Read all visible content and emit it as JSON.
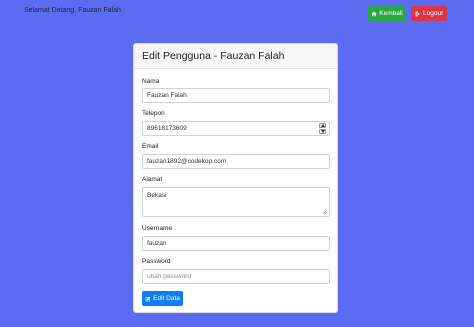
{
  "header": {
    "welcome": "Selamat Datang, Fauzan Falah",
    "back_label": "Kembali",
    "logout_label": "Logout"
  },
  "card": {
    "title": "Edit Pengguna - Fauzan Falah"
  },
  "form": {
    "nama_label": "Nama",
    "nama_value": "Fauzan Falah",
    "telepon_label": "Telepon",
    "telepon_value": "89618173609",
    "email_label": "Email",
    "email_value": "fauzan1892@codekop.com",
    "alamat_label": "Alamat",
    "alamat_value": "Bekasi",
    "username_label": "Username",
    "username_value": "fauzan",
    "password_label": "Password",
    "password_placeholder": "ubah password",
    "submit_label": "Edit Data"
  },
  "colors": {
    "background": "#5b6cf3",
    "back_button": "#28a745",
    "logout_button": "#dc3545",
    "submit_button": "#0d7ef5"
  },
  "icons": {
    "back": "home-icon",
    "logout": "sign-out-icon",
    "submit": "edit-icon"
  }
}
